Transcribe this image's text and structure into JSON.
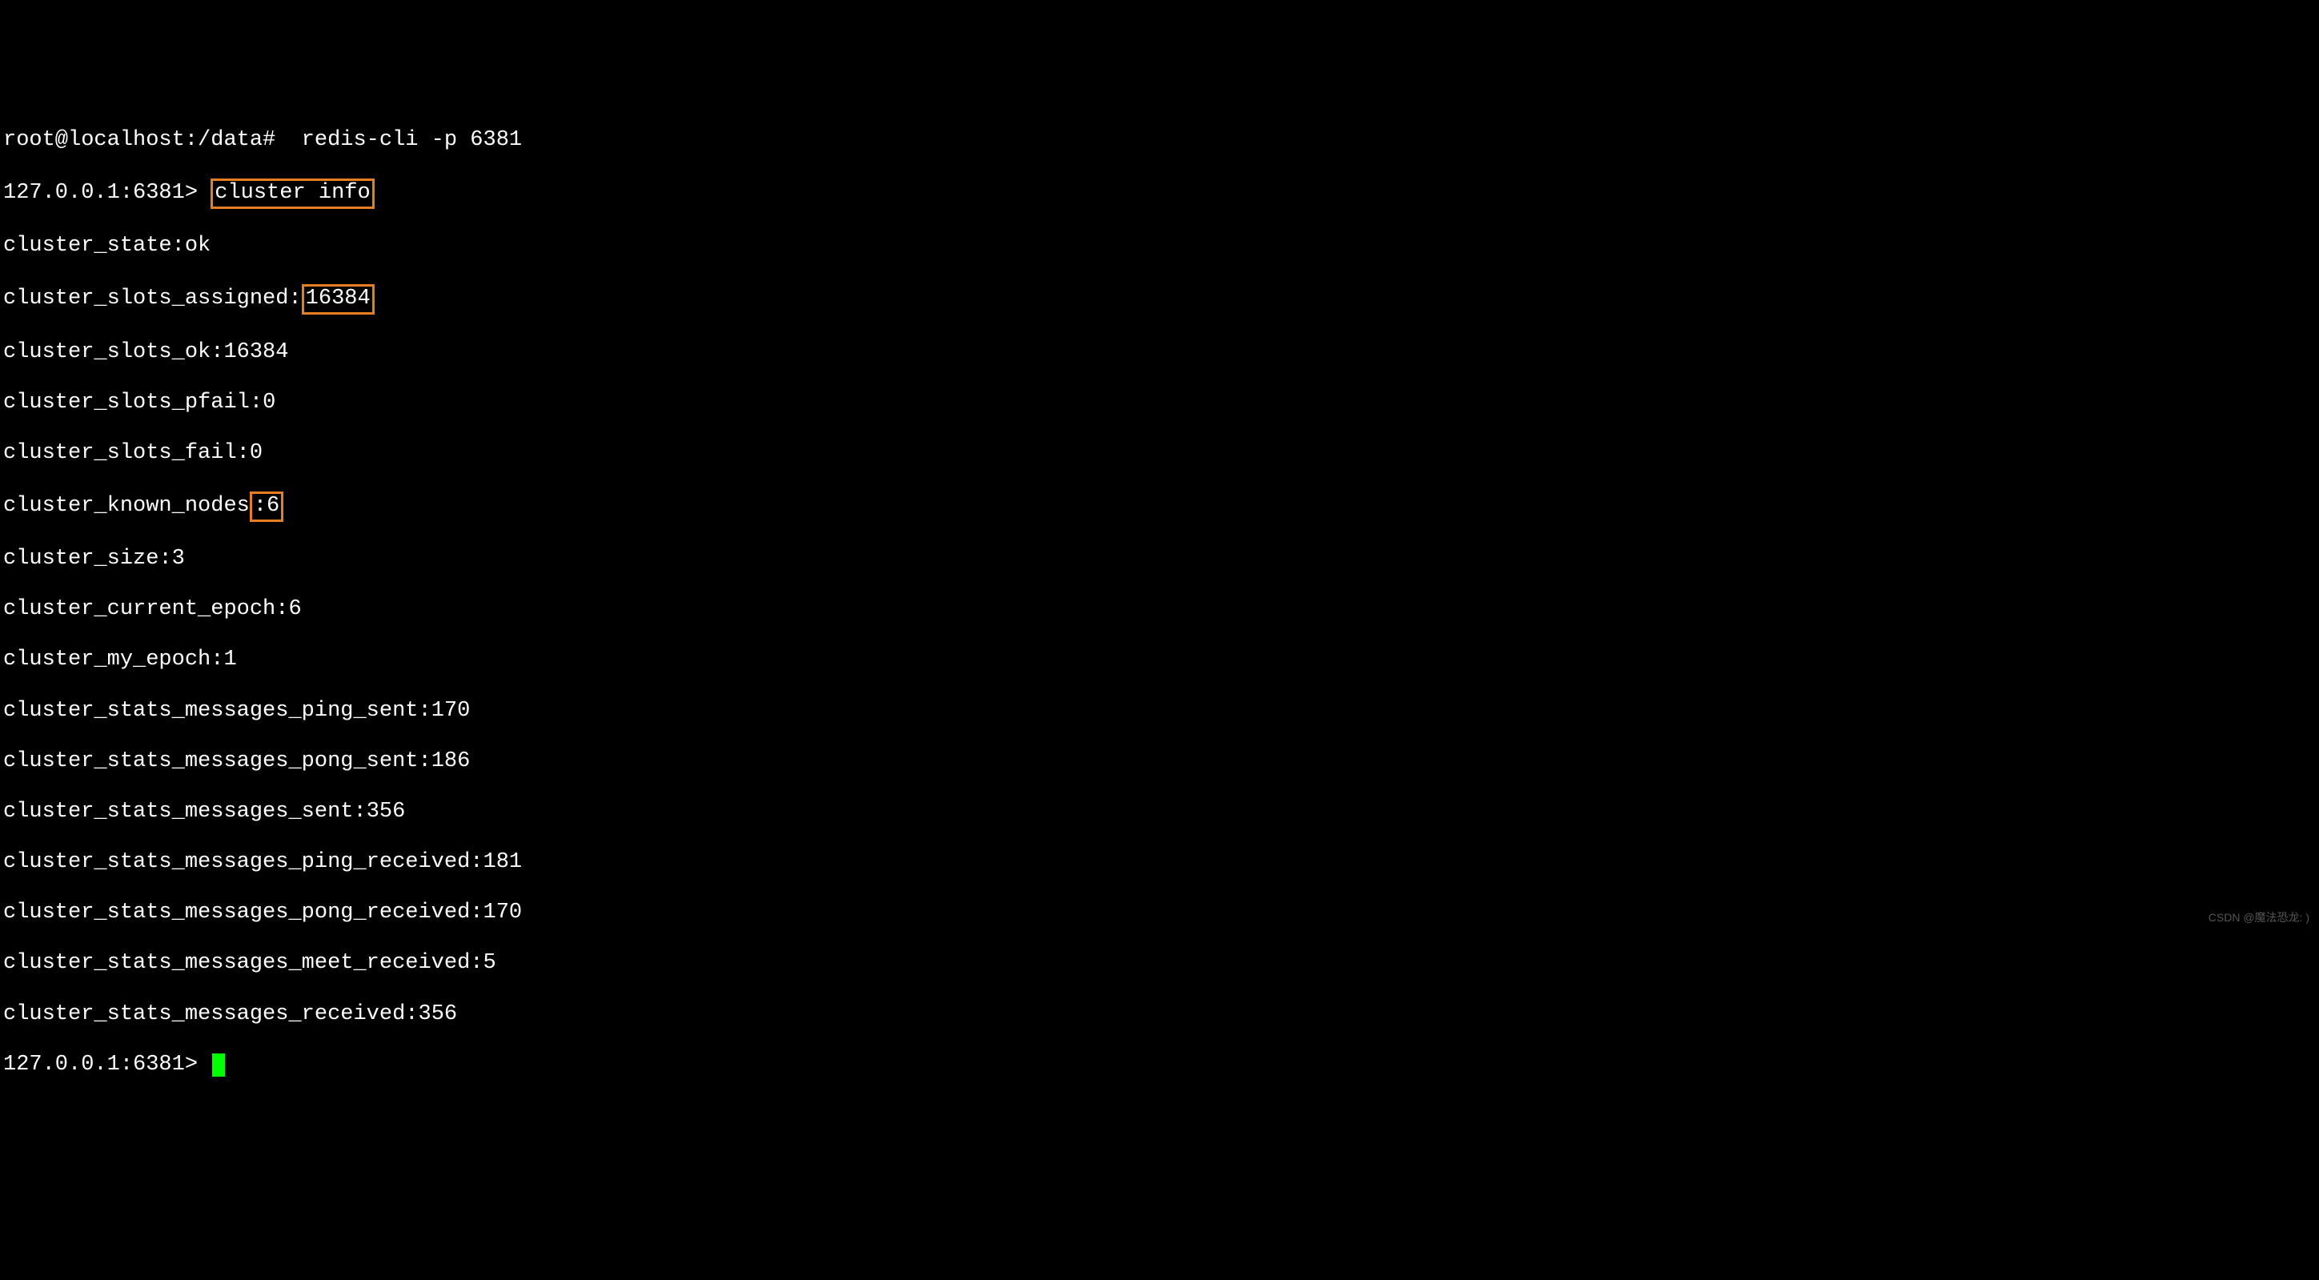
{
  "shell": {
    "prompt_line": "root@localhost:/data#  redis-cli -p 6381",
    "cli_prompt": "127.0.0.1:6381>",
    "command": "cluster info"
  },
  "output": {
    "cluster_state": {
      "key": "cluster_state",
      "value": "ok"
    },
    "cluster_slots_assigned": {
      "key": "cluster_slots_assigned",
      "value": "16384"
    },
    "cluster_slots_ok": {
      "key": "cluster_slots_ok",
      "value": "16384"
    },
    "cluster_slots_pfail": {
      "key": "cluster_slots_pfail",
      "value": "0"
    },
    "cluster_slots_fail": {
      "key": "cluster_slots_fail",
      "value": "0"
    },
    "cluster_known_nodes": {
      "key": "cluster_known_nodes",
      "value": ":6"
    },
    "cluster_size": {
      "key": "cluster_size",
      "value": "3"
    },
    "cluster_current_epoch": {
      "key": "cluster_current_epoch",
      "value": "6"
    },
    "cluster_my_epoch": {
      "key": "cluster_my_epoch",
      "value": "1"
    },
    "ping_sent": {
      "key": "cluster_stats_messages_ping_sent",
      "value": "170"
    },
    "pong_sent": {
      "key": "cluster_stats_messages_pong_sent",
      "value": "186"
    },
    "messages_sent": {
      "key": "cluster_stats_messages_sent",
      "value": "356"
    },
    "ping_received": {
      "key": "cluster_stats_messages_ping_received",
      "value": "181"
    },
    "pong_received": {
      "key": "cluster_stats_messages_pong_received",
      "value": "170"
    },
    "meet_received": {
      "key": "cluster_stats_messages_meet_received",
      "value": "5"
    },
    "messages_received": {
      "key": "cluster_stats_messages_received",
      "value": "356"
    }
  },
  "highlights": {
    "command_boxed": "cluster info",
    "slots_boxed": "16384",
    "nodes_boxed": ":6"
  },
  "watermark": "CSDN @魔法恐龙: )"
}
